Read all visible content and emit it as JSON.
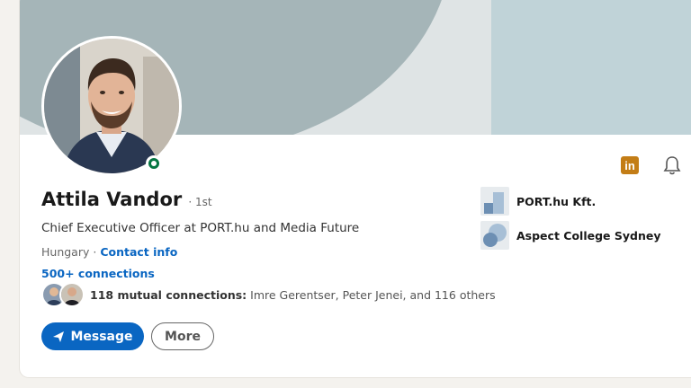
{
  "profile": {
    "name": "Attila Vandor",
    "degree": "· 1st",
    "headline": "Chief Executive Officer at PORT.hu and Media Future",
    "location": "Hungary ·",
    "contact_info": "Contact info",
    "connections": "500+ connections",
    "mutual_bold": "118 mutual connections:",
    "mutual_rest": " Imre Gerentser, Peter Jenei, and 116 others"
  },
  "actions": {
    "message_label": "Message",
    "more_label": "More"
  },
  "companies": [
    {
      "name": "PORT.hu Kft."
    },
    {
      "name": "Aspect College Sydney"
    }
  ],
  "header_icons": {
    "linkedin": "in",
    "bell": "bell-icon"
  },
  "colors": {
    "accent": "#0a66c2",
    "online": "#057642",
    "linkedin_badge": "#c37d16"
  }
}
